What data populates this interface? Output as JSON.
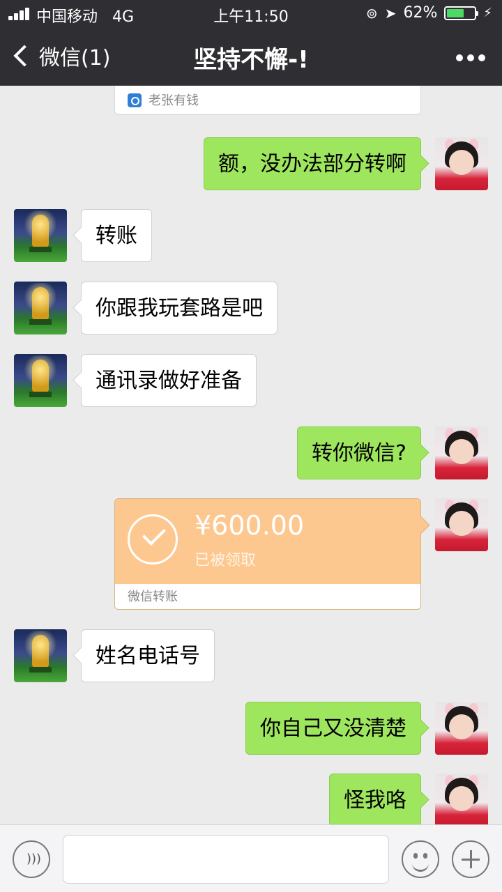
{
  "status_bar": {
    "carrier": "中国移动",
    "network": "4G",
    "time": "上午11:50",
    "battery_percent": "62%",
    "battery_level": 0.62
  },
  "nav": {
    "back_label": "微信(1)",
    "title": "坚持不懈-!"
  },
  "shared_card": {
    "source": "老张有钱"
  },
  "messages": [
    {
      "side": "right",
      "text": "额，没办法部分转啊"
    },
    {
      "side": "left",
      "text": "转账"
    },
    {
      "side": "left",
      "text": "你跟我玩套路是吧"
    },
    {
      "side": "left",
      "text": "通讯录做好准备"
    },
    {
      "side": "right",
      "text": "转你微信?"
    },
    {
      "side": "left",
      "text": "姓名电话号"
    },
    {
      "side": "right",
      "text": "你自己又没清楚"
    },
    {
      "side": "right",
      "text": "怪我咯"
    }
  ],
  "transfer": {
    "amount": "¥600.00",
    "status": "已被领取",
    "footer": "微信转账"
  },
  "colors": {
    "bubble_right": "#9fe65f",
    "bubble_left": "#ffffff",
    "transfer": "#fdc890",
    "topbar": "#2f2f33"
  }
}
